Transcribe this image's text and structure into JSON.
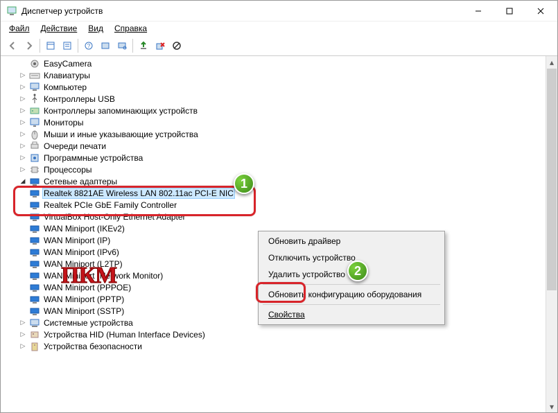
{
  "title": "Диспетчер устройств",
  "menu": {
    "file": "Файл",
    "action": "Действие",
    "view": "Вид",
    "help": "Справка"
  },
  "tree": {
    "easycamera": "EasyCamera",
    "keyboards": "Клавиатуры",
    "computer": "Компьютер",
    "usb": "Контроллеры USB",
    "storage": "Контроллеры запоминающих устройств",
    "monitors": "Мониторы",
    "mice": "Мыши и иные указывающие устройства",
    "printqueues": "Очереди печати",
    "software": "Программные устройства",
    "cpus": "Процессоры",
    "net": "Сетевые адаптеры",
    "net_items": [
      "Realtek 8821AE Wireless LAN 802.11ac PCI-E NIC",
      "Realtek PCIe GbE Family Controller",
      "VirtualBox Host-Only Ethernet Adapter",
      "WAN Miniport (IKEv2)",
      "WAN Miniport (IP)",
      "WAN Miniport (IPv6)",
      "WAN Miniport (L2TP)",
      "WAN Miniport (Network Monitor)",
      "WAN Miniport (PPPOE)",
      "WAN Miniport (PPTP)",
      "WAN Miniport (SSTP)"
    ],
    "system": "Системные устройства",
    "hid": "Устройства HID (Human Interface Devices)",
    "security": "Устройства безопасности"
  },
  "context": {
    "update": "Обновить драйвер",
    "disable": "Отключить устройство",
    "uninstall": "Удалить устройство",
    "scan": "Обновить конфигурацию оборудования",
    "props": "Свойства"
  },
  "annotation": {
    "pkm": "ПКМ",
    "one": "1",
    "two": "2"
  }
}
